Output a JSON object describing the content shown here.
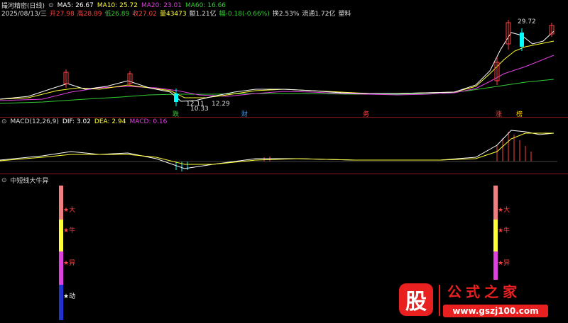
{
  "price_panel": {
    "title": "撮河精密(日线)",
    "ma": [
      {
        "label": "MA5: 26.67",
        "color": "#ffffff"
      },
      {
        "label": "MA10: 25.72",
        "color": "#ffff33"
      },
      {
        "label": "MA20: 23.01",
        "color": "#e040e0"
      },
      {
        "label": "MA60: 16.66",
        "color": "#33cc33"
      }
    ],
    "quote": [
      {
        "label": "2025/08/13/三",
        "color": "#dddddd"
      },
      {
        "label": "开27.98",
        "color": "#ff4040"
      },
      {
        "label": "高28.89",
        "color": "#ff4040"
      },
      {
        "label": "低26.89",
        "color": "#33cc33"
      },
      {
        "label": "收27.02",
        "color": "#ff4040"
      },
      {
        "label": "量43473",
        "color": "#ffff33"
      },
      {
        "label": "额1.21亿",
        "color": "#dddddd"
      },
      {
        "label": "幅-0.18(-0.66%)",
        "color": "#33cc33"
      },
      {
        "label": "换2.53%",
        "color": "#dddddd"
      },
      {
        "label": "流通1.72亿",
        "color": "#dddddd"
      },
      {
        "label": "塑料",
        "color": "#dddddd"
      }
    ],
    "high_label": "29.72",
    "low_labels": [
      "12.11",
      "12.29",
      "10.33"
    ],
    "event_tags": [
      {
        "text": "跌",
        "color": "#33cc33"
      },
      {
        "text": "财",
        "color": "#3399ff"
      },
      {
        "text": "务",
        "color": "#ff4040"
      },
      {
        "text": "涨",
        "color": "#ff4040"
      },
      {
        "text": "榜",
        "color": "#ffcc00"
      }
    ]
  },
  "macd_panel": {
    "title": "MACD(12,26,9)",
    "dif": "DIF: 3.02",
    "dea": "DEA: 2.94",
    "macd": "MACD: 0.16",
    "macd_color": "#e040e0"
  },
  "indicator_panel": {
    "title": "中短线大牛异",
    "signals": [
      "★大",
      "★牛",
      "★异",
      "★动"
    ],
    "signal_colors": [
      "#ff4040",
      "#ff4040",
      "#ff4040",
      "#ffffff"
    ]
  },
  "watermark": {
    "logo_char": "股",
    "name": "公式之家",
    "url": "www.gszj100.com"
  }
}
